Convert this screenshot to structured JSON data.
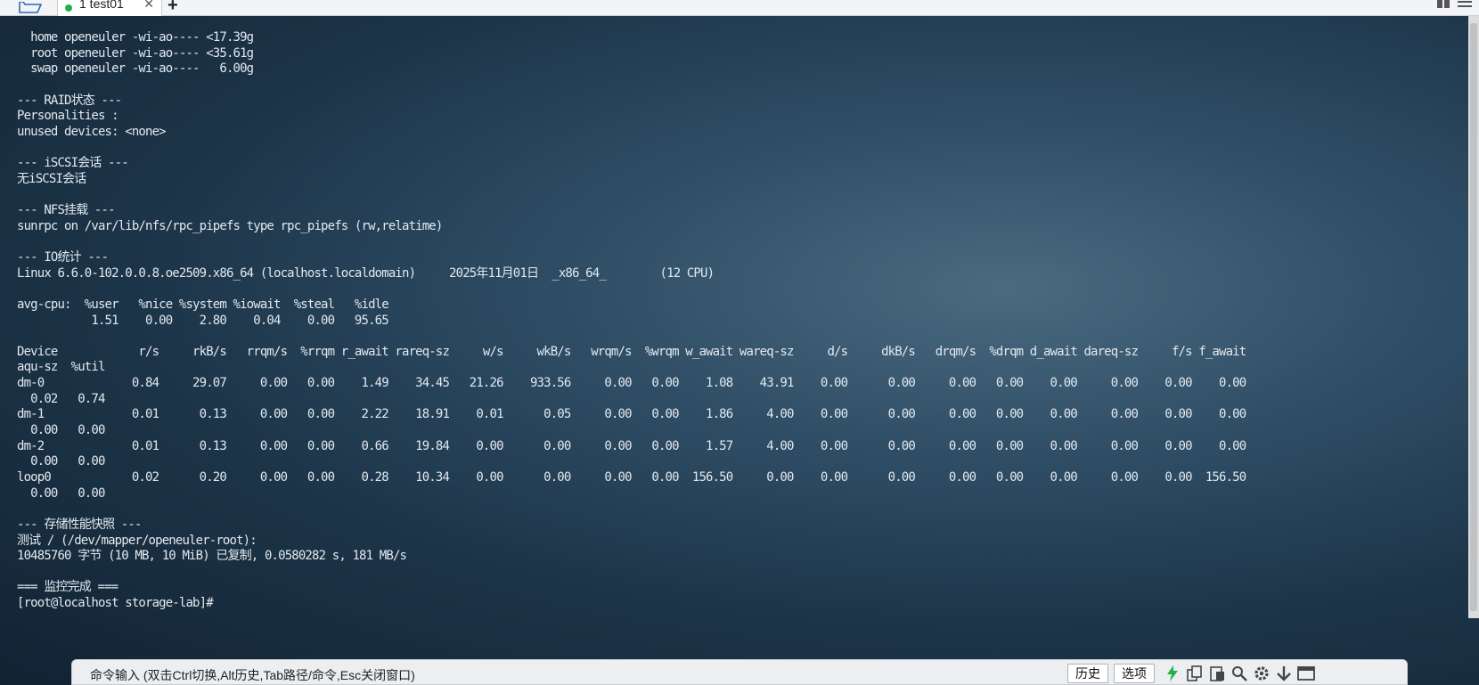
{
  "tabs": [
    {
      "label": "1 test01",
      "status_color": "#22b14c"
    }
  ],
  "icons": {
    "folder": "folder-icon",
    "tab_close": "close-icon",
    "tab_add": "plus-icon"
  },
  "glyphs": {
    "close": "✕",
    "add": "+"
  },
  "terminal": {
    "lines": [
      "  home openeuler -wi-ao---- <17.39g",
      "  root openeuler -wi-ao---- <35.61g",
      "  swap openeuler -wi-ao----   6.00g",
      "",
      "--- RAID状态 ---",
      "Personalities :",
      "unused devices: <none>",
      "",
      "--- iSCSI会话 ---",
      "无iSCSI会话",
      "",
      "--- NFS挂载 ---",
      "sunrpc on /var/lib/nfs/rpc_pipefs type rpc_pipefs (rw,relatime)",
      "",
      "--- IO统计 ---",
      "Linux 6.6.0-102.0.0.8.oe2509.x86_64 (localhost.localdomain)     2025年11月01日  _x86_64_        (12 CPU)",
      "",
      "avg-cpu:  %user   %nice %system %iowait  %steal   %idle",
      "           1.51    0.00    2.80    0.04    0.00   95.65",
      "",
      "Device            r/s     rkB/s   rrqm/s  %rrqm r_await rareq-sz     w/s     wkB/s   wrqm/s  %wrqm w_await wareq-sz     d/s     dkB/s   drqm/s  %drqm d_await dareq-sz     f/s f_await",
      "aqu-sz  %util",
      "dm-0             0.84     29.07     0.00   0.00    1.49    34.45   21.26    933.56     0.00   0.00    1.08    43.91    0.00      0.00     0.00   0.00    0.00     0.00    0.00    0.00",
      "  0.02   0.74",
      "dm-1             0.01      0.13     0.00   0.00    2.22    18.91    0.01      0.05     0.00   0.00    1.86     4.00    0.00      0.00     0.00   0.00    0.00     0.00    0.00    0.00",
      "  0.00   0.00",
      "dm-2             0.01      0.13     0.00   0.00    0.66    19.84    0.00      0.00     0.00   0.00    1.57     4.00    0.00      0.00     0.00   0.00    0.00     0.00    0.00    0.00",
      "  0.00   0.00",
      "loop0            0.02      0.20     0.00   0.00    0.28    10.34    0.00      0.00     0.00   0.00  156.50     0.00    0.00      0.00     0.00   0.00    0.00     0.00    0.00  156.50",
      "  0.00   0.00",
      "",
      "--- 存储性能快照 ---",
      "测试 / (/dev/mapper/openeuler-root):",
      "10485760 字节 (10 MB, 10 MiB) 已复制, 0.0580282 s, 181 MB/s",
      "",
      "=== 监控完成 ===",
      "[root@localhost storage-lab]#"
    ]
  },
  "command_bar": {
    "placeholder": "命令输入 (双击Ctrl切换,Alt历史,Tab路径/命令,Esc关闭窗口)",
    "history_label": "历史",
    "options_label": "选项",
    "icons": [
      "lightning-icon",
      "copy-icon",
      "paste-icon",
      "search-icon",
      "gear-icon",
      "arrow-down-icon",
      "window-icon"
    ]
  },
  "colors": {
    "terminal_text": "#e3e9ef",
    "background": "#1d3549",
    "tab_status": "#22b14c",
    "lightning": "#22b14c"
  }
}
